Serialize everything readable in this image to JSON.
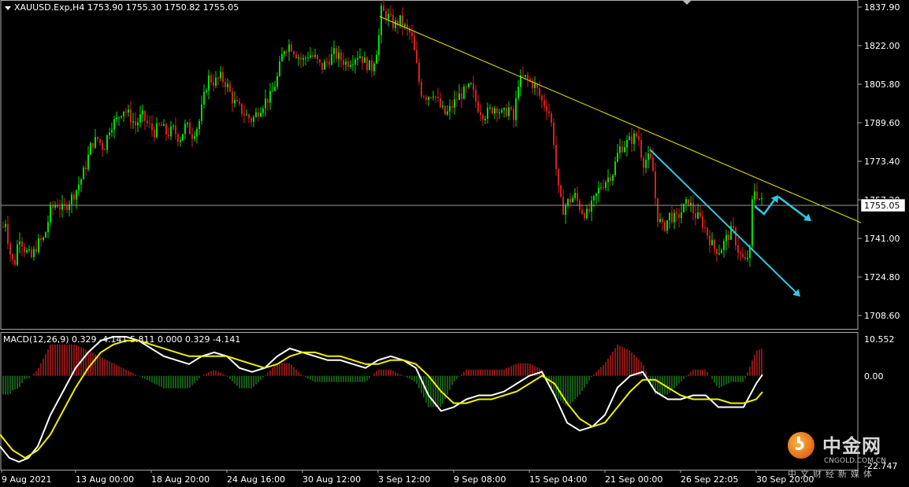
{
  "header": {
    "price_info": "XAUUSD.Exp,H4  1753.90 1755.30 1750.82 1755.05",
    "macd_info": "MACD(12,26,9) 0.329 -4.141 5.811 0.000 0.329 -4.141"
  },
  "price_axis": {
    "labels": [
      "1837.90",
      "1822.00",
      "1805.80",
      "1789.60",
      "1773.40",
      "1757.20",
      "1741.00",
      "1724.80",
      "1708.60"
    ],
    "current_price": "1755.05",
    "ymin": 1702,
    "ymax": 1840
  },
  "macd_axis": {
    "labels": [
      "10.552",
      "0.00",
      "-22.747"
    ]
  },
  "time_axis": {
    "labels": [
      "9 Aug 2021",
      "13 Aug 00:00",
      "18 Aug 20:00",
      "24 Aug 16:00",
      "30 Aug 12:00",
      "3 Sep 12:00",
      "9 Sep 08:00",
      "15 Sep 04:00",
      "21 Sep 00:00",
      "26 Sep 22:05",
      "30 Sep 20:00"
    ]
  },
  "watermark": {
    "name": "中金网",
    "site": "CNGOLD.COM.CN",
    "sub": "中文财经新媒体"
  },
  "colors": {
    "background": "#000000",
    "bull": "#00e000",
    "bear": "#d62020",
    "trendline": "#e6e600",
    "arrow": "#30c8e0",
    "macd_main": "#ffffff",
    "macd_signal": "#f0f000",
    "macd_hist_pos": "#c02020",
    "macd_hist_neg": "#208020"
  },
  "chart_data": {
    "type": "candlestick",
    "symbol": "XAUUSD.Exp",
    "timeframe": "H4",
    "price_path": [
      [
        0,
        1735
      ],
      [
        6,
        1750
      ],
      [
        12,
        1735
      ],
      [
        18,
        1728
      ],
      [
        24,
        1742
      ],
      [
        32,
        1735
      ],
      [
        40,
        1732
      ],
      [
        48,
        1738
      ],
      [
        56,
        1740
      ],
      [
        64,
        1752
      ],
      [
        72,
        1755
      ],
      [
        80,
        1752
      ],
      [
        88,
        1756
      ],
      [
        96,
        1760
      ],
      [
        104,
        1766
      ],
      [
        110,
        1772
      ],
      [
        116,
        1780
      ],
      [
        124,
        1782
      ],
      [
        132,
        1778
      ],
      [
        140,
        1788
      ],
      [
        148,
        1790
      ],
      [
        156,
        1795
      ],
      [
        164,
        1792
      ],
      [
        172,
        1788
      ],
      [
        180,
        1792
      ],
      [
        188,
        1788
      ],
      [
        196,
        1785
      ],
      [
        204,
        1788
      ],
      [
        212,
        1784
      ],
      [
        220,
        1786
      ],
      [
        228,
        1782
      ],
      [
        236,
        1788
      ],
      [
        244,
        1784
      ],
      [
        252,
        1788
      ],
      [
        258,
        1798
      ],
      [
        264,
        1808
      ],
      [
        272,
        1806
      ],
      [
        280,
        1808
      ],
      [
        288,
        1805
      ],
      [
        296,
        1798
      ],
      [
        304,
        1795
      ],
      [
        312,
        1792
      ],
      [
        320,
        1790
      ],
      [
        328,
        1794
      ],
      [
        336,
        1798
      ],
      [
        344,
        1800
      ],
      [
        352,
        1808
      ],
      [
        360,
        1820
      ],
      [
        368,
        1822
      ],
      [
        376,
        1818
      ],
      [
        384,
        1815
      ],
      [
        392,
        1818
      ],
      [
        400,
        1816
      ],
      [
        408,
        1812
      ],
      [
        416,
        1815
      ],
      [
        424,
        1818
      ],
      [
        432,
        1816
      ],
      [
        440,
        1814
      ],
      [
        448,
        1816
      ],
      [
        456,
        1818
      ],
      [
        464,
        1814
      ],
      [
        472,
        1812
      ],
      [
        480,
        1822
      ],
      [
        484,
        1836
      ],
      [
        492,
        1834
      ],
      [
        500,
        1830
      ],
      [
        508,
        1832
      ],
      [
        516,
        1828
      ],
      [
        522,
        1826
      ],
      [
        528,
        1815
      ],
      [
        534,
        1802
      ],
      [
        542,
        1800
      ],
      [
        550,
        1802
      ],
      [
        558,
        1796
      ],
      [
        566,
        1792
      ],
      [
        574,
        1796
      ],
      [
        582,
        1800
      ],
      [
        590,
        1802
      ],
      [
        598,
        1804
      ],
      [
        606,
        1796
      ],
      [
        614,
        1792
      ],
      [
        622,
        1794
      ],
      [
        630,
        1796
      ],
      [
        638,
        1792
      ],
      [
        646,
        1795
      ],
      [
        652,
        1790
      ],
      [
        658,
        1806
      ],
      [
        666,
        1808
      ],
      [
        674,
        1806
      ],
      [
        680,
        1804
      ],
      [
        688,
        1798
      ],
      [
        696,
        1795
      ],
      [
        702,
        1785
      ],
      [
        708,
        1762
      ],
      [
        714,
        1752
      ],
      [
        722,
        1756
      ],
      [
        730,
        1758
      ],
      [
        738,
        1752
      ],
      [
        746,
        1750
      ],
      [
        754,
        1756
      ],
      [
        762,
        1762
      ],
      [
        770,
        1765
      ],
      [
        778,
        1768
      ],
      [
        786,
        1778
      ],
      [
        794,
        1780
      ],
      [
        802,
        1782
      ],
      [
        810,
        1784
      ],
      [
        816,
        1772
      ],
      [
        822,
        1774
      ],
      [
        828,
        1772
      ],
      [
        834,
        1750
      ],
      [
        842,
        1744
      ],
      [
        850,
        1750
      ],
      [
        858,
        1748
      ],
      [
        866,
        1752
      ],
      [
        874,
        1756
      ],
      [
        882,
        1750
      ],
      [
        890,
        1748
      ],
      [
        898,
        1742
      ],
      [
        906,
        1736
      ],
      [
        914,
        1735
      ],
      [
        922,
        1740
      ],
      [
        930,
        1744
      ],
      [
        938,
        1734
      ],
      [
        946,
        1730
      ],
      [
        952,
        1735
      ],
      [
        956,
        1762
      ],
      [
        962,
        1758
      ],
      [
        968,
        1755
      ]
    ],
    "trendline": [
      [
        0.0,
        1836
      ],
      [
        1.0,
        1748
      ]
    ],
    "trendline2": [
      [
        0.0,
        1775
      ],
      [
        1.0,
        1738
      ]
    ],
    "macd_main": [
      [
        0,
        -18
      ],
      [
        12,
        -21
      ],
      [
        24,
        -22
      ],
      [
        36,
        -21
      ],
      [
        48,
        -18
      ],
      [
        64,
        -10
      ],
      [
        80,
        -4
      ],
      [
        96,
        2
      ],
      [
        112,
        6
      ],
      [
        128,
        9
      ],
      [
        144,
        10
      ],
      [
        160,
        10
      ],
      [
        176,
        9
      ],
      [
        192,
        7
      ],
      [
        208,
        5
      ],
      [
        224,
        4
      ],
      [
        240,
        3
      ],
      [
        256,
        5
      ],
      [
        272,
        6
      ],
      [
        288,
        5
      ],
      [
        304,
        2
      ],
      [
        320,
        1
      ],
      [
        336,
        2
      ],
      [
        352,
        5
      ],
      [
        368,
        7
      ],
      [
        384,
        6
      ],
      [
        400,
        5
      ],
      [
        416,
        4
      ],
      [
        432,
        4
      ],
      [
        448,
        3
      ],
      [
        464,
        2
      ],
      [
        480,
        4
      ],
      [
        496,
        5
      ],
      [
        512,
        4
      ],
      [
        528,
        2
      ],
      [
        544,
        -5
      ],
      [
        560,
        -9
      ],
      [
        576,
        -8
      ],
      [
        592,
        -6
      ],
      [
        608,
        -5
      ],
      [
        624,
        -5
      ],
      [
        640,
        -4
      ],
      [
        656,
        -2
      ],
      [
        672,
        0
      ],
      [
        688,
        1
      ],
      [
        704,
        -5
      ],
      [
        720,
        -12
      ],
      [
        736,
        -14
      ],
      [
        752,
        -13
      ],
      [
        768,
        -10
      ],
      [
        784,
        -3
      ],
      [
        800,
        0
      ],
      [
        816,
        1
      ],
      [
        832,
        -4
      ],
      [
        848,
        -6
      ],
      [
        864,
        -6
      ],
      [
        880,
        -5
      ],
      [
        896,
        -5
      ],
      [
        912,
        -8
      ],
      [
        928,
        -8
      ],
      [
        944,
        -8
      ],
      [
        960,
        -2
      ],
      [
        968,
        0.3
      ]
    ],
    "macd_signal": [
      [
        0,
        -15
      ],
      [
        16,
        -19
      ],
      [
        32,
        -21
      ],
      [
        48,
        -19
      ],
      [
        64,
        -15
      ],
      [
        80,
        -9
      ],
      [
        96,
        -3
      ],
      [
        112,
        2
      ],
      [
        128,
        6
      ],
      [
        144,
        8
      ],
      [
        160,
        9
      ],
      [
        176,
        9
      ],
      [
        192,
        8
      ],
      [
        208,
        7
      ],
      [
        224,
        6
      ],
      [
        240,
        5
      ],
      [
        256,
        5
      ],
      [
        272,
        5
      ],
      [
        288,
        5
      ],
      [
        304,
        4
      ],
      [
        320,
        3
      ],
      [
        336,
        2
      ],
      [
        352,
        3
      ],
      [
        368,
        5
      ],
      [
        384,
        6
      ],
      [
        400,
        6
      ],
      [
        416,
        5
      ],
      [
        432,
        5
      ],
      [
        448,
        4
      ],
      [
        464,
        3
      ],
      [
        480,
        3
      ],
      [
        496,
        4
      ],
      [
        512,
        4
      ],
      [
        528,
        3
      ],
      [
        544,
        0
      ],
      [
        560,
        -4
      ],
      [
        576,
        -7
      ],
      [
        592,
        -7
      ],
      [
        608,
        -6
      ],
      [
        624,
        -6
      ],
      [
        640,
        -5
      ],
      [
        656,
        -4
      ],
      [
        672,
        -2
      ],
      [
        688,
        0
      ],
      [
        704,
        -2
      ],
      [
        720,
        -7
      ],
      [
        736,
        -11
      ],
      [
        752,
        -13
      ],
      [
        768,
        -12
      ],
      [
        784,
        -8
      ],
      [
        800,
        -4
      ],
      [
        816,
        -1
      ],
      [
        832,
        -1
      ],
      [
        848,
        -3
      ],
      [
        864,
        -5
      ],
      [
        880,
        -6
      ],
      [
        896,
        -6
      ],
      [
        912,
        -6
      ],
      [
        928,
        -7
      ],
      [
        944,
        -7
      ],
      [
        960,
        -6
      ],
      [
        968,
        -4.1
      ]
    ],
    "ylim": [
      1702,
      1840
    ]
  }
}
